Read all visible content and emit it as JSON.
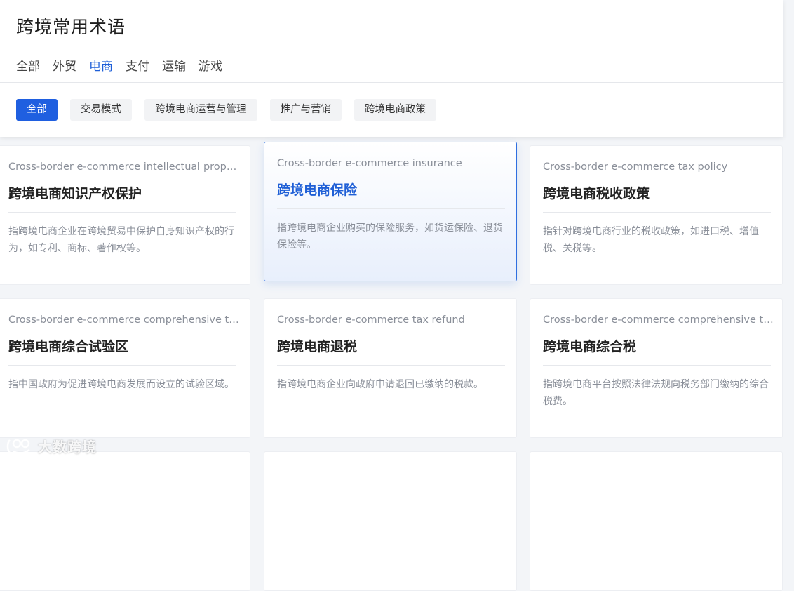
{
  "header": {
    "title": "跨境常用术语",
    "main_tabs": [
      {
        "label": "全部",
        "active": false
      },
      {
        "label": "外贸",
        "active": false
      },
      {
        "label": "电商",
        "active": true
      },
      {
        "label": "支付",
        "active": false
      },
      {
        "label": "运输",
        "active": false
      },
      {
        "label": "游戏",
        "active": false
      }
    ],
    "sub_tabs": [
      {
        "label": "全部",
        "active": true
      },
      {
        "label": "交易模式",
        "active": false
      },
      {
        "label": "跨境电商运营与管理",
        "active": false
      },
      {
        "label": "推广与营销",
        "active": false
      },
      {
        "label": "跨境电商政策",
        "active": false
      }
    ]
  },
  "cards": [
    {
      "en": "Cross-border e-commerce intellectual property protection",
      "zh": "跨境电商知识产权保护",
      "desc": "指跨境电商企业在跨境贸易中保护自身知识产权的行为，如专利、商标、著作权等。",
      "highlight": false
    },
    {
      "en": "Cross-border e-commerce insurance",
      "zh": "跨境电商保险",
      "desc": "指跨境电商企业购买的保险服务，如货运保险、退货保险等。",
      "highlight": true
    },
    {
      "en": "Cross-border e-commerce tax policy",
      "zh": "跨境电商税收政策",
      "desc": "指针对跨境电商行业的税收政策，如进口税、增值税、关税等。",
      "highlight": false
    },
    {
      "en": "Cross-border e-commerce comprehensive test zone",
      "zh": "跨境电商综合试验区",
      "desc": "指中国政府为促进跨境电商发展而设立的试验区域。",
      "highlight": false
    },
    {
      "en": "Cross-border e-commerce tax refund",
      "zh": "跨境电商退税",
      "desc": "指跨境电商企业向政府申请退回已缴纳的税款。",
      "highlight": false
    },
    {
      "en": "Cross-border e-commerce comprehensive tax",
      "zh": "跨境电商综合税",
      "desc": "指跨境电商平台按照法律法规向税务部门缴纳的综合税费。",
      "highlight": false
    }
  ],
  "watermark": {
    "text": "大数跨境",
    "icon": "logo-icon"
  },
  "colors": {
    "accent": "#1f5fe0",
    "active_tab_text": "#1e5fd8",
    "muted_text": "#8a8f99"
  }
}
